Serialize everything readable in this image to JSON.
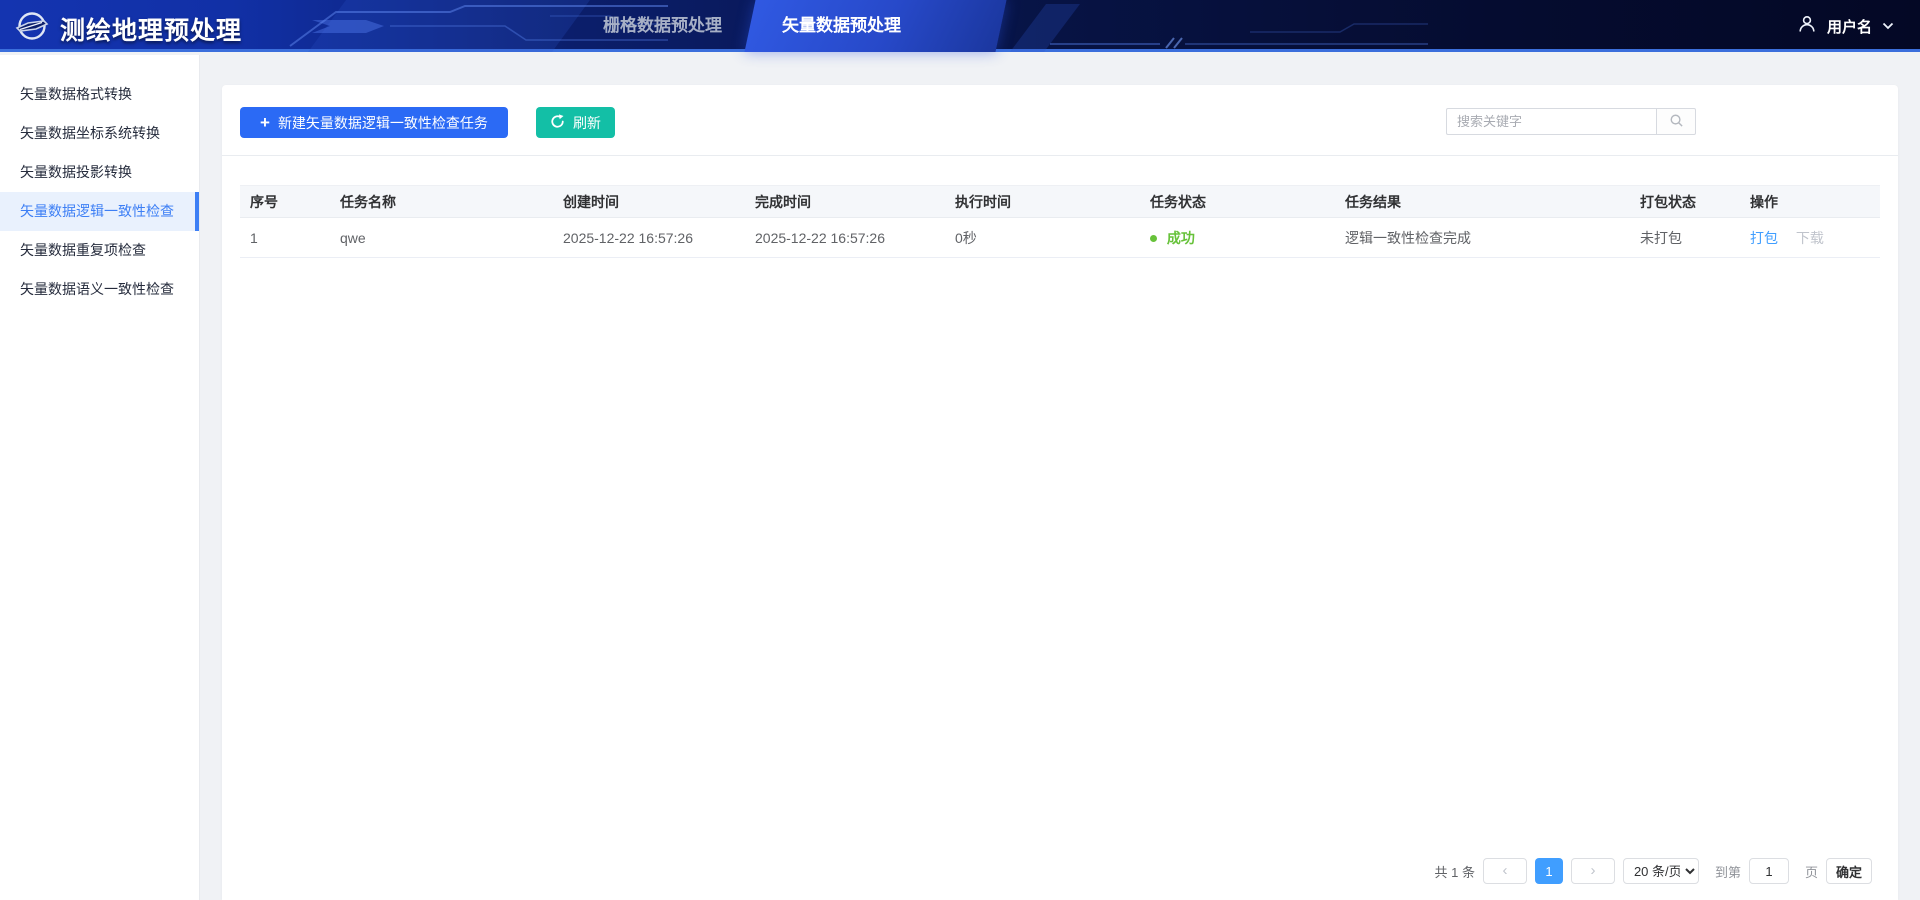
{
  "header": {
    "title": "测绘地理预处理",
    "tabs": [
      {
        "label": "栅格数据预处理",
        "active": false
      },
      {
        "label": "矢量数据预处理",
        "active": true
      }
    ],
    "user": {
      "name": "用户名"
    }
  },
  "sidebar": {
    "items": [
      {
        "label": "矢量数据格式转换",
        "active": false
      },
      {
        "label": "矢量数据坐标系统转换",
        "active": false
      },
      {
        "label": "矢量数据投影转换",
        "active": false
      },
      {
        "label": "矢量数据逻辑一致性检查",
        "active": true
      },
      {
        "label": "矢量数据重复项检查",
        "active": false
      },
      {
        "label": "矢量数据语义一致性检查",
        "active": false
      }
    ]
  },
  "toolbar": {
    "new_task_label": "新建矢量数据逻辑一致性检查任务",
    "refresh_label": "刷新"
  },
  "search": {
    "placeholder": "搜索关键字"
  },
  "table": {
    "columns": [
      "序号",
      "任务名称",
      "创建时间",
      "完成时间",
      "执行时间",
      "任务状态",
      "任务结果",
      "打包状态",
      "操作"
    ],
    "rows": [
      {
        "index": "1",
        "name": "qwe",
        "created": "2025-12-22 16:57:26",
        "finished": "2025-12-22 16:57:26",
        "duration": "0秒",
        "status": "成功",
        "result": "逻辑一致性检查完成",
        "package_status": "未打包",
        "action_package": "打包",
        "action_download": "下载"
      }
    ]
  },
  "pagination": {
    "total_label": "共 1 条",
    "prev_glyph": "‹",
    "current_page": "1",
    "next_glyph": "›",
    "page_size_label": "20 条/页",
    "goto_prefix": "到第",
    "goto_value": "1",
    "goto_suffix": "页",
    "confirm_label": "确定"
  },
  "colors": {
    "primary_button": "#2b6af5",
    "refresh_button": "#13bfa6",
    "success": "#67c23a",
    "link": "#409eff",
    "sidebar_active": "#3d7ff5",
    "header_tab_active": "#2c52d8",
    "header_underline": "#3b6fdc"
  }
}
